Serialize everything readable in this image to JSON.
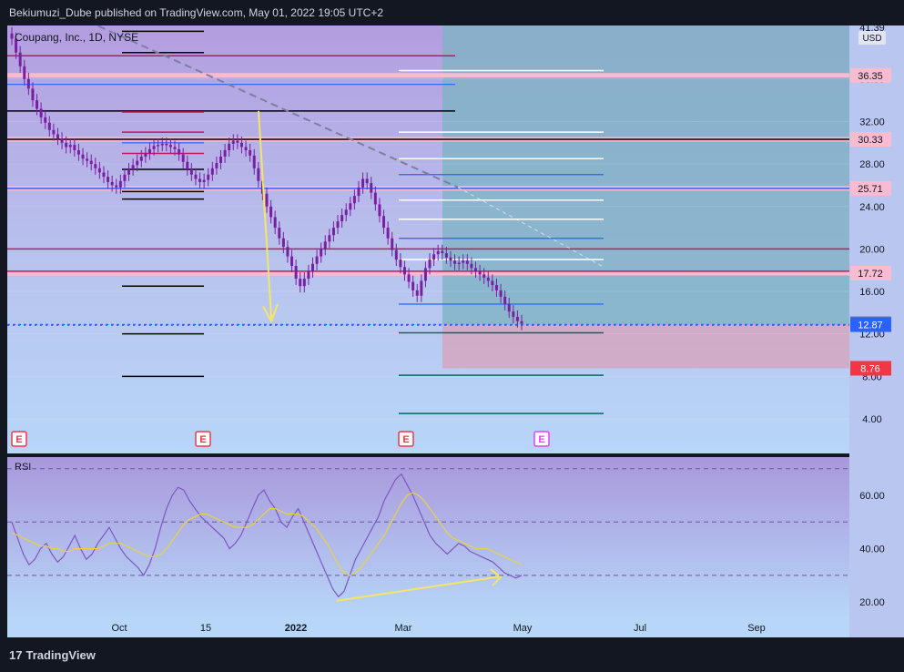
{
  "header": {
    "text": "Bekiumuzi_Dube published on TradingView.com, May 01, 2022 19:05 UTC+2"
  },
  "footer": {
    "logo_mark": "17",
    "logo_text": "TradingView"
  },
  "colors": {
    "bg_purple": "#b9a3e3",
    "bg_blue": "#b7d4f7",
    "target_zone": "#7fb3c6",
    "stop_zone": "#d5a6c0",
    "candle": "#7b1fa2",
    "rsi_line": "#7e57c2",
    "rsi_ma": "#e8d33d",
    "arrow": "#f5e663",
    "pink_level": "#f8bbd0",
    "current_price": "#2962ff",
    "stop_label": "#f23645"
  },
  "chart_data": [
    {
      "type": "candlestick",
      "title": "Coupang, Inc., 1D, NYSE",
      "currency": "USD",
      "x_ticks": [
        "Oct",
        "15",
        "2022",
        "Mar",
        "May",
        "Jul",
        "Sep"
      ],
      "y_ticks": [
        4,
        8,
        12,
        16,
        20,
        24,
        28,
        32,
        36
      ],
      "ylim": [
        0,
        41.39
      ],
      "top_value_label": "41.39",
      "price_labels": [
        {
          "value": 36.35,
          "text": "36.35",
          "style": "pink"
        },
        {
          "value": 30.33,
          "text": "30.33",
          "style": "pink"
        },
        {
          "value": 25.71,
          "text": "25.71",
          "style": "pink"
        },
        {
          "value": 17.72,
          "text": "17.72",
          "style": "pink"
        },
        {
          "value": 12.96,
          "text": "12.96",
          "style": "gray"
        },
        {
          "value": 12.87,
          "text": "12.87",
          "style": "blue"
        },
        {
          "value": 8.76,
          "text": "8.76",
          "style": "red"
        }
      ],
      "close_series": [
        39.8,
        38.5,
        37.2,
        36.0,
        35.1,
        34.0,
        33.2,
        32.4,
        31.9,
        31.2,
        30.8,
        30.4,
        30.0,
        29.6,
        29.8,
        29.3,
        28.9,
        28.5,
        28.3,
        28.0,
        27.6,
        27.2,
        26.8,
        26.3,
        26.0,
        25.8,
        26.4,
        27.0,
        27.5,
        27.9,
        28.3,
        28.7,
        29.0,
        29.4,
        29.7,
        29.8,
        29.9,
        29.8,
        29.6,
        29.4,
        28.9,
        28.2,
        27.5,
        27.0,
        26.6,
        26.3,
        26.5,
        27.0,
        27.6,
        28.1,
        28.7,
        29.3,
        29.9,
        30.2,
        30.0,
        29.6,
        29.3,
        28.8,
        27.6,
        26.4,
        25.2,
        24.0,
        23.0,
        22.0,
        21.0,
        20.2,
        19.3,
        18.4,
        17.2,
        16.5,
        17.2,
        17.9,
        18.6,
        19.3,
        20.0,
        20.7,
        21.3,
        22.0,
        22.6,
        23.2,
        23.7,
        24.3,
        25.0,
        25.8,
        26.6,
        26.2,
        25.3,
        24.2,
        23.1,
        22.0,
        21.0,
        19.9,
        19.0,
        18.3,
        17.6,
        16.9,
        16.1,
        15.6,
        17.0,
        18.2,
        19.0,
        19.5,
        19.8,
        19.6,
        19.2,
        18.9,
        18.6,
        18.7,
        18.9,
        18.6,
        18.2,
        17.9,
        17.6,
        17.3,
        17.0,
        16.6,
        16.1,
        15.5,
        14.8,
        14.1,
        13.6,
        13.2,
        12.96
      ],
      "x_start_date": "2021-09-01",
      "annotation_arrows": [
        "downward yellow arrow",
        "rising RSI divergence arrow"
      ],
      "event_markers": [
        "E",
        "E",
        "E",
        "E"
      ]
    },
    {
      "type": "line",
      "title": "RSI",
      "y_ticks": [
        20,
        40,
        60
      ],
      "ylim": [
        14,
        80
      ],
      "levels": [
        70,
        50,
        30
      ],
      "series": [
        {
          "name": "",
          "values": [
            50,
            44,
            38,
            34,
            36,
            40,
            42,
            38,
            35,
            37,
            41,
            45,
            40,
            36,
            38,
            42,
            45,
            48,
            44,
            40,
            37,
            35,
            33,
            30,
            34,
            40,
            48,
            55,
            60,
            63,
            62,
            58,
            55,
            52,
            50,
            48,
            46,
            44,
            40,
            42,
            45,
            50,
            55,
            60,
            62,
            58,
            55,
            50,
            48,
            52,
            55,
            50,
            45,
            40,
            35,
            30,
            25,
            22,
            24,
            30,
            36,
            40,
            44,
            48,
            52,
            58,
            62,
            66,
            68,
            64,
            60,
            55,
            50,
            45,
            42,
            40,
            38,
            40,
            42,
            41,
            39,
            38,
            37,
            36,
            35,
            33,
            31,
            30,
            29,
            30
          ]
        },
        {
          "name": "",
          "values": [
            46,
            45,
            44,
            43,
            42,
            41,
            41,
            40,
            40,
            39,
            39,
            40,
            40,
            40,
            40,
            40,
            41,
            42,
            42,
            42,
            41,
            40,
            39,
            38,
            37,
            37,
            38,
            40,
            43,
            46,
            49,
            51,
            52,
            53,
            53,
            52,
            51,
            50,
            49,
            48,
            48,
            48,
            49,
            51,
            53,
            55,
            55,
            54,
            53,
            53,
            53,
            52,
            50,
            48,
            45,
            42,
            38,
            34,
            31,
            30,
            31,
            33,
            36,
            39,
            42,
            45,
            49,
            53,
            57,
            60,
            61,
            60,
            58,
            55,
            52,
            49,
            46,
            44,
            43,
            42,
            41,
            40,
            40,
            40,
            39,
            38,
            37,
            36,
            35,
            34
          ]
        }
      ]
    }
  ]
}
